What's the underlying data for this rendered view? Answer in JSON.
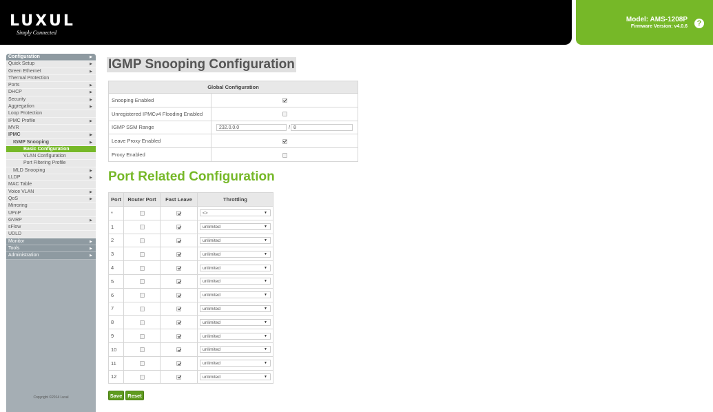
{
  "header": {
    "logo": "LUXUL",
    "tagline": "Simply Connected",
    "model": "Model: AMS-1208P",
    "firmware": "Firmware Version: v4.0.6",
    "help_icon": "question-circle-icon"
  },
  "sidebar": {
    "items": [
      {
        "label": "Configuration",
        "level": "section",
        "arrow": true
      },
      {
        "label": "Quick Setup",
        "level": "1",
        "arrow": true
      },
      {
        "label": "Green Ethernet",
        "level": "1",
        "arrow": true
      },
      {
        "label": "Thermal Protection",
        "level": "1",
        "arrow": false
      },
      {
        "label": "Ports",
        "level": "1",
        "arrow": true
      },
      {
        "label": "DHCP",
        "level": "1",
        "arrow": true
      },
      {
        "label": "Security",
        "level": "1",
        "arrow": true
      },
      {
        "label": "Aggregation",
        "level": "1",
        "arrow": true
      },
      {
        "label": "Loop Protection",
        "level": "1",
        "arrow": false
      },
      {
        "label": "IPMC Profile",
        "level": "1",
        "arrow": true
      },
      {
        "label": "MVR",
        "level": "1",
        "arrow": false
      },
      {
        "label": "IPMC",
        "level": "1b",
        "arrow": true
      },
      {
        "label": "IGMP Snooping",
        "level": "2b",
        "arrow": true
      },
      {
        "label": "Basic Configuration",
        "level": "active",
        "arrow": false
      },
      {
        "label": "VLAN Configuration",
        "level": "3",
        "arrow": false
      },
      {
        "label": "Port Filtering Profile",
        "level": "3",
        "arrow": false
      },
      {
        "label": "MLD Snooping",
        "level": "2",
        "arrow": true
      },
      {
        "label": "LLDP",
        "level": "1",
        "arrow": true
      },
      {
        "label": "MAC Table",
        "level": "1",
        "arrow": false
      },
      {
        "label": "Voice VLAN",
        "level": "1",
        "arrow": true
      },
      {
        "label": "QoS",
        "level": "1",
        "arrow": true
      },
      {
        "label": "Mirroring",
        "level": "1",
        "arrow": false
      },
      {
        "label": "UPnP",
        "level": "1",
        "arrow": false
      },
      {
        "label": "GVRP",
        "level": "1",
        "arrow": true
      },
      {
        "label": "sFlow",
        "level": "1",
        "arrow": false
      },
      {
        "label": "UDLD",
        "level": "1",
        "arrow": false
      },
      {
        "label": "Monitor",
        "level": "section",
        "arrow": true
      },
      {
        "label": "Tools",
        "level": "section",
        "arrow": true
      },
      {
        "label": "Administration",
        "level": "section",
        "arrow": true
      }
    ],
    "copyright": "Copyright ©2014 Luxul"
  },
  "main": {
    "title": "IGMP Snooping Configuration",
    "global": {
      "header": "Global Configuration",
      "rows": {
        "snooping_enabled": {
          "label": "Snooping Enabled",
          "checked": true
        },
        "unregistered_flooding": {
          "label": "Unregistered IPMCv4 Flooding Enabled",
          "checked": false
        },
        "ssm_range": {
          "label": "IGMP SSM Range",
          "address": "232.0.0.0",
          "separator": "/",
          "mask": "8"
        },
        "leave_proxy": {
          "label": "Leave Proxy Enabled",
          "checked": true
        },
        "proxy_enabled": {
          "label": "Proxy Enabled",
          "checked": false
        }
      }
    },
    "port_section_title": "Port Related Configuration",
    "port_table": {
      "headers": [
        "Port",
        "Router Port",
        "Fast Leave",
        "Throttling"
      ],
      "rows": [
        {
          "port": "*",
          "router": false,
          "fast": true,
          "throttling": "<>"
        },
        {
          "port": "1",
          "router": false,
          "fast": true,
          "throttling": "unlimited"
        },
        {
          "port": "2",
          "router": false,
          "fast": true,
          "throttling": "unlimited"
        },
        {
          "port": "3",
          "router": false,
          "fast": true,
          "throttling": "unlimited"
        },
        {
          "port": "4",
          "router": false,
          "fast": true,
          "throttling": "unlimited"
        },
        {
          "port": "5",
          "router": false,
          "fast": true,
          "throttling": "unlimited"
        },
        {
          "port": "6",
          "router": false,
          "fast": true,
          "throttling": "unlimited"
        },
        {
          "port": "7",
          "router": false,
          "fast": true,
          "throttling": "unlimited"
        },
        {
          "port": "8",
          "router": false,
          "fast": true,
          "throttling": "unlimited"
        },
        {
          "port": "9",
          "router": false,
          "fast": true,
          "throttling": "unlimited"
        },
        {
          "port": "10",
          "router": false,
          "fast": true,
          "throttling": "unlimited"
        },
        {
          "port": "11",
          "router": false,
          "fast": true,
          "throttling": "unlimited"
        },
        {
          "port": "12",
          "router": false,
          "fast": true,
          "throttling": "unlimited"
        }
      ]
    },
    "buttons": {
      "save": "Save",
      "reset": "Reset"
    }
  },
  "colors": {
    "accent_green": "#76b828",
    "header_black": "#000000",
    "sidebar_gray": "#a5aeb4"
  }
}
